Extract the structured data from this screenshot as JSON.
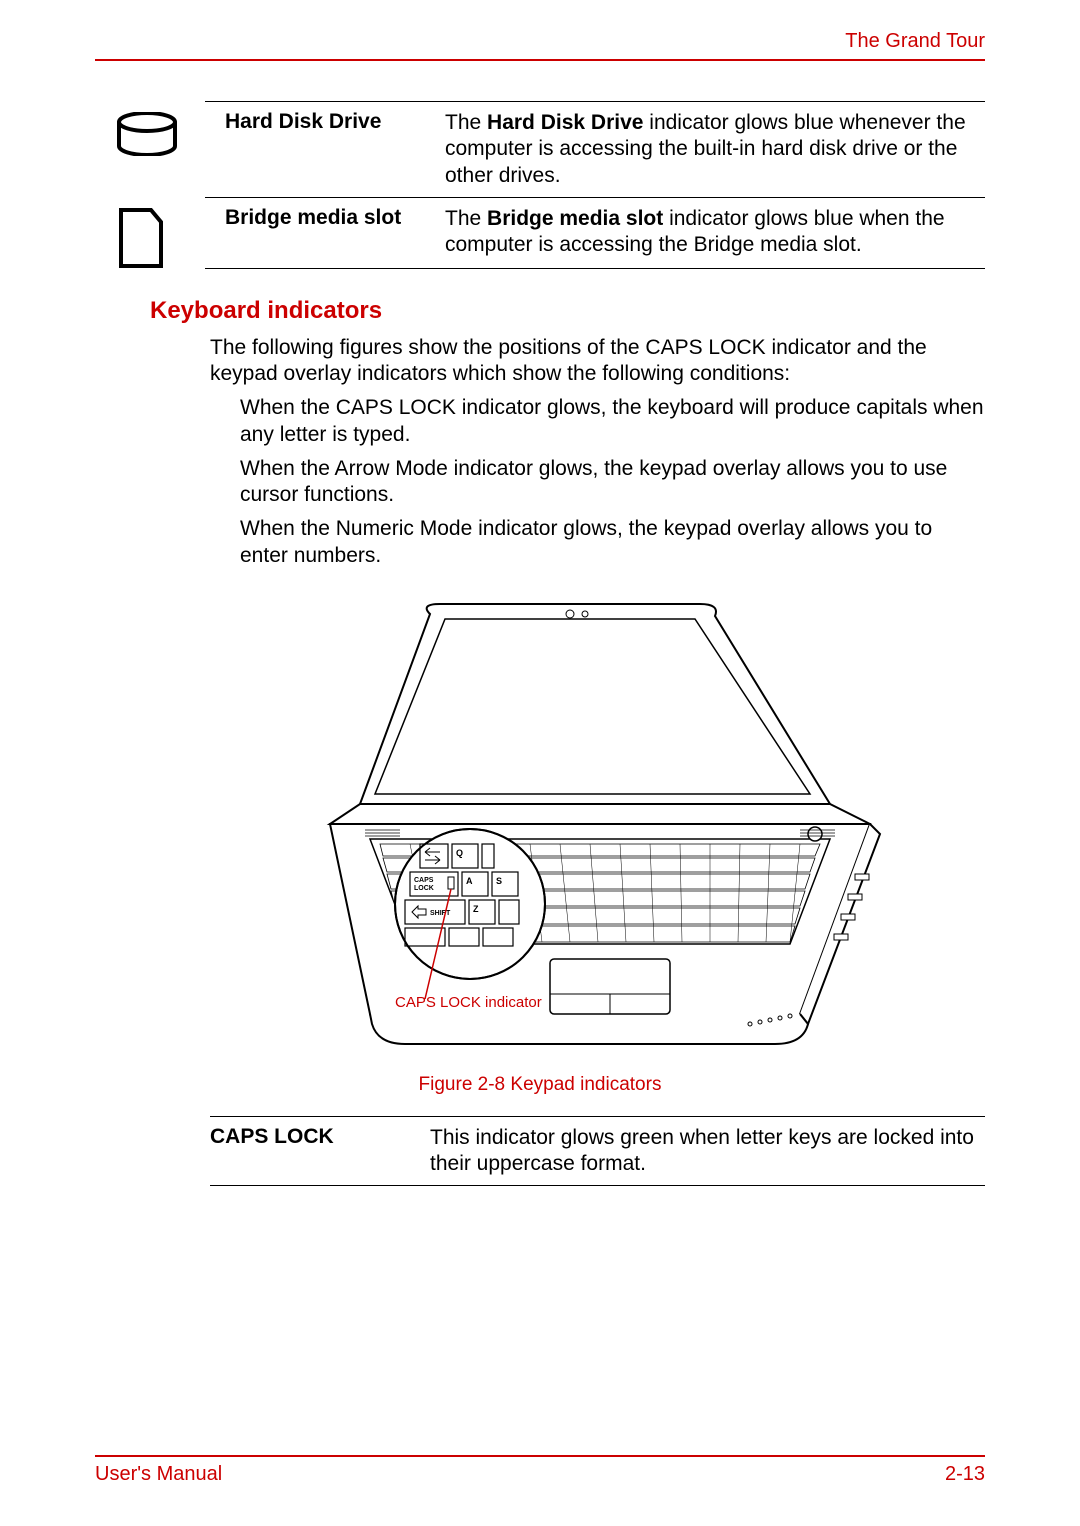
{
  "header": {
    "chapter": "The Grand Tour"
  },
  "indicators": {
    "hdd": {
      "label": "Hard Disk Drive",
      "desc_prefix": "The ",
      "desc_bold": "Hard Disk Drive",
      "desc_rest": " indicator glows blue whenever the computer is accessing the built-in hard disk drive or the other drives."
    },
    "bms": {
      "label": "Bridge media slot",
      "desc_prefix": "The ",
      "desc_bold": "Bridge media slot",
      "desc_rest": " indicator glows blue when the computer is accessing the Bridge media slot."
    }
  },
  "section": {
    "title": "Keyboard indicators"
  },
  "paras": {
    "intro": "The following figures show the positions of the CAPS LOCK indicator and the keypad overlay indicators which show the following conditions:",
    "b1": "When the CAPS LOCK indicator glows, the keyboard will produce capitals when any letter is typed.",
    "b2": "When the Arrow Mode indicator glows, the keypad overlay allows you to use cursor functions.",
    "b3": "When the Numeric Mode indicator glows, the keypad overlay allows you to enter numbers."
  },
  "figure": {
    "callout": "CAPS LOCK indicator",
    "caption": "Figure 2-8 Keypad indicators",
    "zoom_labels": {
      "caps": "CAPS LOCK",
      "shift": "SHIFT",
      "q": "Q",
      "a": "A",
      "z": "Z",
      "s": "S"
    }
  },
  "caps_table": {
    "label": "CAPS LOCK",
    "desc": "This indicator glows green when letter keys are locked into their uppercase format."
  },
  "footer": {
    "left": "User's Manual",
    "right": "2-13"
  }
}
